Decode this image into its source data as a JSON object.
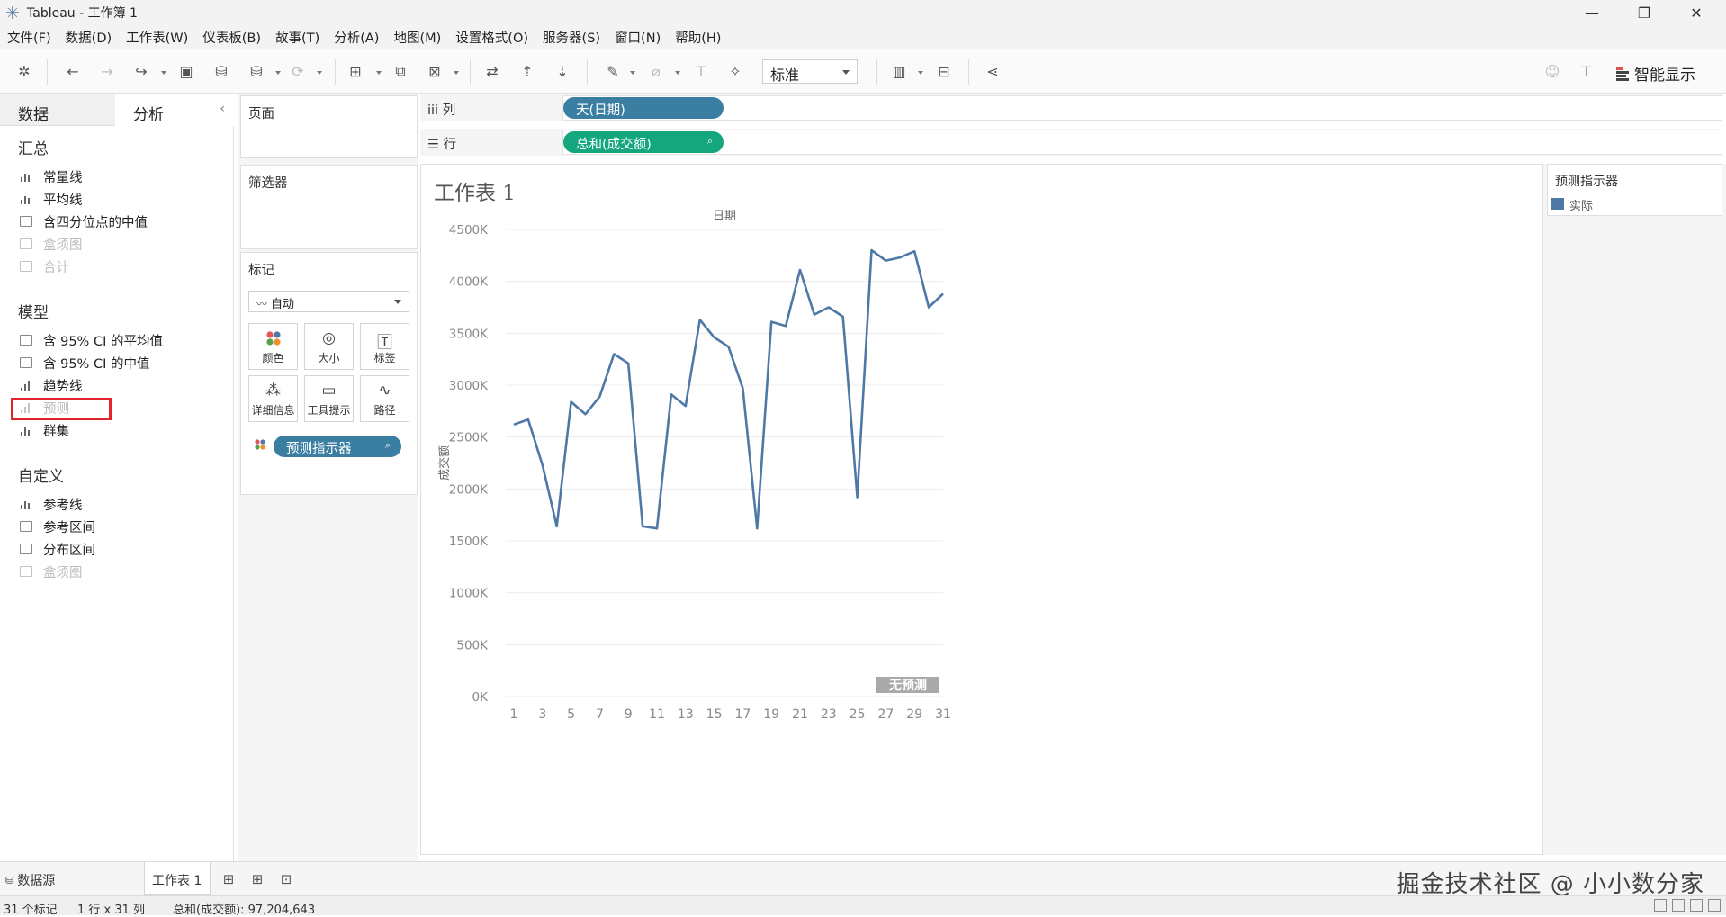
{
  "window": {
    "title": "Tableau - 工作簿 1",
    "minimize": "—",
    "maximize": "❐",
    "close": "✕"
  },
  "menu": [
    "文件(F)",
    "数据(D)",
    "工作表(W)",
    "仪表板(B)",
    "故事(T)",
    "分析(A)",
    "地图(M)",
    "设置格式(O)",
    "服务器(S)",
    "窗口(N)",
    "帮助(H)"
  ],
  "toolbar": {
    "fit_value": "标准",
    "show_me_label": "智能显示"
  },
  "left_pane": {
    "tabs": {
      "data": "数据",
      "analysis": "分析"
    },
    "sections": [
      {
        "title": "汇总",
        "items": [
          {
            "label": "常量线",
            "enabled": true
          },
          {
            "label": "平均线",
            "enabled": true
          },
          {
            "label": "含四分位点的中值",
            "enabled": true
          },
          {
            "label": "盒须图",
            "enabled": false
          },
          {
            "label": "合计",
            "enabled": false
          }
        ]
      },
      {
        "title": "模型",
        "items": [
          {
            "label": "含 95% CI 的平均值",
            "enabled": true
          },
          {
            "label": "含 95% CI 的中值",
            "enabled": true
          },
          {
            "label": "趋势线",
            "enabled": true
          },
          {
            "label": "预测",
            "enabled": false,
            "highlighted": true
          },
          {
            "label": "群集",
            "enabled": true
          }
        ]
      },
      {
        "title": "自定义",
        "items": [
          {
            "label": "参考线",
            "enabled": true
          },
          {
            "label": "参考区间",
            "enabled": true
          },
          {
            "label": "分布区间",
            "enabled": true
          },
          {
            "label": "盒须图",
            "enabled": false
          }
        ]
      }
    ]
  },
  "cards": {
    "pages": "页面",
    "filters": "筛选器",
    "marks": {
      "title": "标记",
      "mark_type": "自动",
      "buttons": [
        "颜色",
        "大小",
        "标签",
        "详细信息",
        "工具提示",
        "路径"
      ],
      "pill": "预测指示器"
    }
  },
  "shelves": {
    "columns": {
      "label": "列",
      "pill": "天(日期)"
    },
    "rows": {
      "label": "行",
      "pill": "总和(成交额)"
    }
  },
  "sheet": {
    "title": "工作表 1",
    "no_forecast_badge": "无预测"
  },
  "legend": {
    "title": "预测指示器",
    "items": [
      {
        "label": "实际",
        "color": "#4e79a7"
      }
    ]
  },
  "chart_data": {
    "type": "line",
    "title": "",
    "top_axis_label": "日期",
    "xlabel": "",
    "ylabel": "成交额",
    "x_ticks": [
      "1",
      "3",
      "5",
      "7",
      "9",
      "11",
      "13",
      "15",
      "17",
      "19",
      "21",
      "23",
      "25",
      "27",
      "29",
      "31"
    ],
    "y_ticks": [
      "0K",
      "500K",
      "1000K",
      "1500K",
      "2000K",
      "2500K",
      "3000K",
      "3500K",
      "4000K",
      "4500K"
    ],
    "ylim": [
      0,
      4500000
    ],
    "xlim": [
      1,
      31
    ],
    "grid": true,
    "series": [
      {
        "name": "实际",
        "color": "#4e79a7",
        "x": [
          1,
          2,
          3,
          4,
          5,
          6,
          7,
          8,
          9,
          10,
          11,
          12,
          13,
          14,
          15,
          16,
          17,
          18,
          19,
          20,
          21,
          22,
          23,
          24,
          25,
          26,
          27,
          28,
          29,
          30,
          31
        ],
        "values": [
          2620000,
          2670000,
          2230000,
          1640000,
          2840000,
          2720000,
          2890000,
          3300000,
          3210000,
          1640000,
          1620000,
          2910000,
          2800000,
          3630000,
          3460000,
          3370000,
          2970000,
          1620000,
          3610000,
          3570000,
          4110000,
          3680000,
          3750000,
          3660000,
          1920000,
          4300000,
          4200000,
          4230000,
          4290000,
          3750000,
          3880000
        ]
      }
    ]
  },
  "bottom": {
    "datasource_tab": "数据源",
    "sheet_tab": "工作表 1",
    "watermark": "掘金技术社区 @ 小小数分家"
  },
  "status": {
    "marks": "31 个标记",
    "dims": "1 行 x 31 列",
    "sum": "总和(成交额): 97,204,643"
  }
}
